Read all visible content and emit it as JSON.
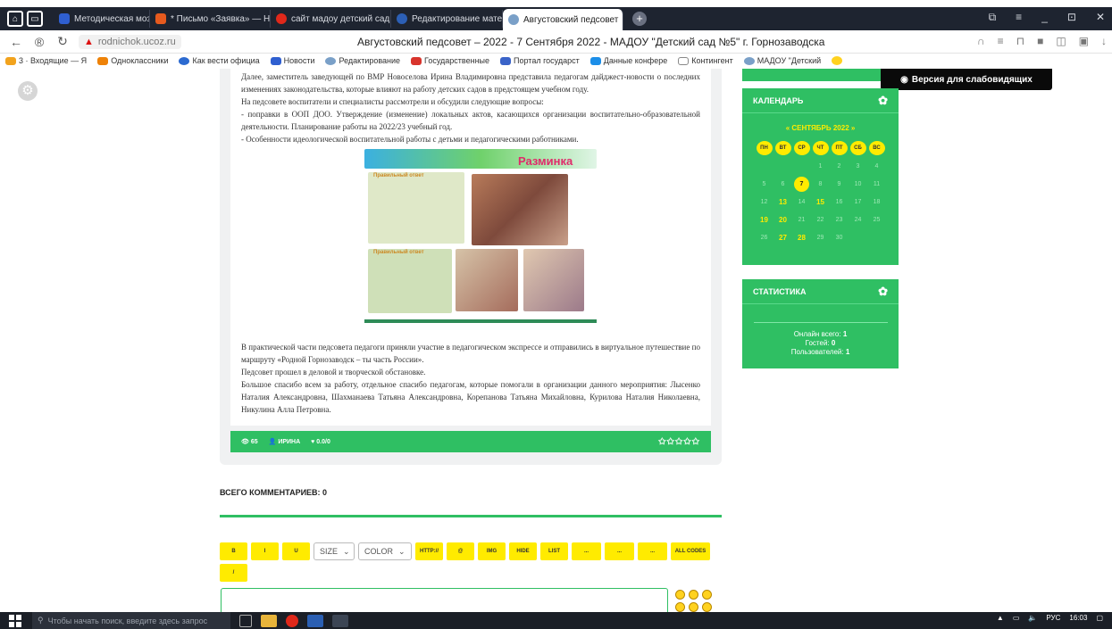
{
  "tabs": [
    {
      "label": "Методическая мозаика М",
      "color": "#2f5fd0"
    },
    {
      "label": "* Письмо «Заявка» — Нат",
      "color": "#e65a1e"
    },
    {
      "label": "сайт мадоу детский сад 5",
      "color": "#e0281a"
    },
    {
      "label": "Редактирование материа",
      "color": "#2c5fb5"
    },
    {
      "label": "Августовский педсовет",
      "color": "#7aa0c8"
    }
  ],
  "newtab_glyph": "+",
  "address": {
    "url": "rodnichok.ucoz.ru",
    "page_title": "Августовский педсовет – 2022 - 7 Сентября 2022 - МАДОУ \"Детский сад №5\" г. Горнозаводска"
  },
  "bookmarks": [
    "3 · Входящие — Я",
    "Одноклассники",
    "Как вести официа",
    "Новости",
    "Редактирование",
    "Государственные",
    "Портал государст",
    "Данные конфере",
    "Контингент",
    "МАДОУ \"Детский"
  ],
  "article": {
    "paragraph1": "Далее, заместитель заведующей по ВМР Новоселова Ирина Владимировна представила педагогам дайджест-новости о последних изменениях законодательства, которые влияют на работу детских садов в предстоящем учебном году.",
    "paragraph2": "На педсовете воспитатели и специалисты рассмотрели и обсудили следующие вопросы:",
    "paragraph3": "- поправки в ООП ДОО. Утверждение (изменение) локальных актов, касающихся организации воспитательно-образовательной деятельности. Планирование работы на 2022/23 учебный год.",
    "paragraph4": "- Особенности идеологической воспитательной работы с детьми и педагогическими работниками.",
    "collage_title": "Разминка",
    "collage_label1": "Правильный ответ",
    "collage_label2": "Правильный ответ",
    "paragraph5": "В практической части педсовета педагоги приняли участие в педагогическом экспрессе и отправились в виртуальное путешествие по маршруту «Родной Горнозаводск – ты часть России».",
    "paragraph6": "Педсовет прошел в деловой и творческой обстановке.",
    "paragraph7": "Большое спасибо всем за работу, отдельное спасибо педагогам, которые помогали в организации данного мероприятия: Лысенко Наталия Александровна, Шахманаева Татьяна Александровна, Корепанова Татьяна Михайловна, Курилова Наталия Николаевна, Никулина Алла Петровна.",
    "views": "65",
    "author": "ИРИНА",
    "rating": "0.0/0",
    "stars": "✩✩✩✩✩"
  },
  "comments": {
    "heading": "ВСЕГО КОММЕНТАРИЕВ: 0",
    "toolbar": {
      "bold": "B",
      "italic": "I",
      "underline": "U",
      "size": "SIZE",
      "color": "COLOR",
      "http": "HTTP://",
      "at": "@",
      "img": "IMG",
      "hide": "HIDE",
      "list": "LIST",
      "blank1": "...",
      "blank2": "...",
      "blank3": "...",
      "all_codes": "ALL CODES",
      "slash": "/"
    }
  },
  "vision_button": "Версия для слабовидящих",
  "calendar": {
    "title": "КАЛЕНДАРЬ",
    "month": "« СЕНТЯБРЬ 2022 »",
    "weekdays": [
      "ПН",
      "ВТ",
      "СР",
      "ЧТ",
      "ПТ",
      "СБ",
      "ВС"
    ],
    "cells": [
      "",
      "",
      "",
      "1",
      "2",
      "3",
      "4",
      "5",
      "6",
      "7",
      "8",
      "9",
      "10",
      "11",
      "12",
      "13",
      "14",
      "15",
      "16",
      "17",
      "18",
      "19",
      "20",
      "21",
      "22",
      "23",
      "24",
      "25",
      "26",
      "27",
      "28",
      "29",
      "30",
      "",
      ""
    ],
    "bold_days": [
      "13",
      "15",
      "19",
      "20",
      "27",
      "28"
    ],
    "today": "7"
  },
  "stats": {
    "title": "СТАТИСТИКА",
    "online_label": "Онлайн всего:",
    "online": "1",
    "guests_label": "Гостей:",
    "guests": "0",
    "users_label": "Пользователей:",
    "users": "1"
  },
  "taskbar": {
    "search_placeholder": "Чтобы начать поиск, введите здесь запрос",
    "lang": "РУС",
    "time": "16:03"
  },
  "colors": {
    "accent": "#2fbf63",
    "yellow": "#ffeb00"
  }
}
